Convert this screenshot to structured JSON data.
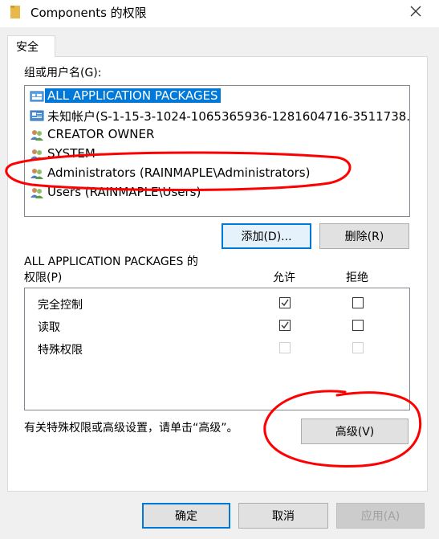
{
  "window": {
    "title": "Components 的权限",
    "close_label": "✕"
  },
  "tabs": [
    {
      "label": "安全"
    }
  ],
  "group_label": "组或用户名(G):",
  "users": [
    {
      "name": "ALL APPLICATION PACKAGES",
      "icon": "app-packages-icon",
      "selected": true
    },
    {
      "name": "未知帐户(S-1-15-3-1024-1065365936-1281604716-3511738...",
      "icon": "unknown-account-icon",
      "selected": false
    },
    {
      "name": "CREATOR OWNER",
      "icon": "users-group-icon",
      "selected": false
    },
    {
      "name": "SYSTEM",
      "icon": "users-group-icon",
      "selected": false
    },
    {
      "name": "Administrators (RAINMAPLE\\Administrators)",
      "icon": "users-group-icon",
      "selected": false
    },
    {
      "name": "Users (RAINMAPLE\\Users)",
      "icon": "users-group-icon",
      "selected": false
    }
  ],
  "buttons": {
    "add": "添加(D)...",
    "remove": "删除(R)",
    "advanced": "高级(V)",
    "ok": "确定",
    "cancel": "取消",
    "apply": "应用(A)"
  },
  "permissions": {
    "heading_line1": "ALL APPLICATION PACKAGES 的",
    "heading_line2": "权限(P)",
    "allow_label": "允许",
    "deny_label": "拒绝",
    "rows": [
      {
        "name": "完全控制",
        "allow": true,
        "deny": false,
        "enabled": true
      },
      {
        "name": "读取",
        "allow": true,
        "deny": false,
        "enabled": true
      },
      {
        "name": "特殊权限",
        "allow": false,
        "deny": false,
        "enabled": false
      }
    ]
  },
  "advanced_hint": "有关特殊权限或高级设置，请单击“高级”。",
  "colors": {
    "selection": "#0078d7",
    "annotation": "#ff0000"
  }
}
